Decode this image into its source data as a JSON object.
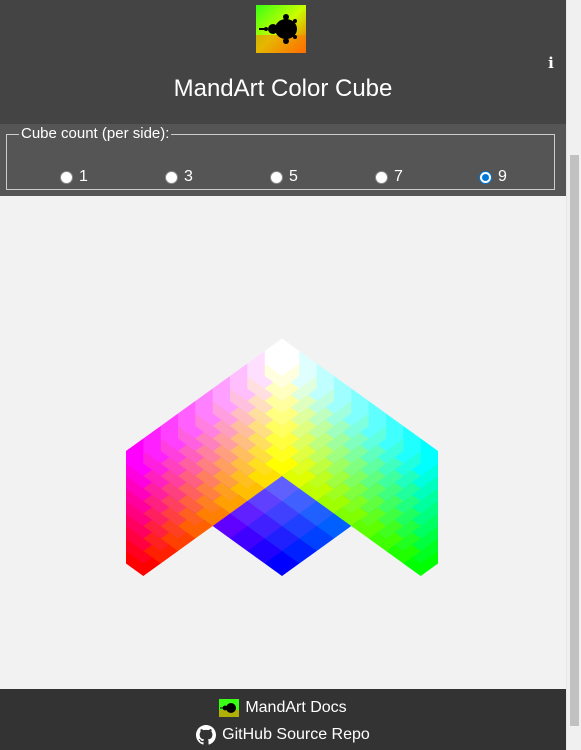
{
  "header": {
    "title": "MandArt Color Cube",
    "logo_icon": "mandelbrot-logo-icon",
    "info_label": "i"
  },
  "controls": {
    "legend": "Cube count (per side):",
    "options": [
      {
        "label": "1",
        "checked": false
      },
      {
        "label": "3",
        "checked": false
      },
      {
        "label": "5",
        "checked": false
      },
      {
        "label": "7",
        "checked": false
      },
      {
        "label": "9",
        "checked": true
      }
    ]
  },
  "cube": {
    "count_per_side": 9,
    "background": "#f2f2f2",
    "corner_colors": {
      "top": "#ffffff",
      "upper_left": "#ff00ff",
      "upper_right": "#00ffff",
      "center": "#ffff00",
      "lower_left": "#ff0000",
      "lower_right": "#00ff00",
      "bottom": "#000000"
    }
  },
  "footer": {
    "docs_label": "MandArt Docs",
    "repo_label": "GitHub Source Repo",
    "docs_icon": "mandelbrot-logo-icon",
    "repo_icon": "github-icon"
  },
  "colors": {
    "header_bg": "#444444",
    "controls_bg": "#555555",
    "footer_bg": "#333333",
    "radio_accent": "#0078d7"
  }
}
